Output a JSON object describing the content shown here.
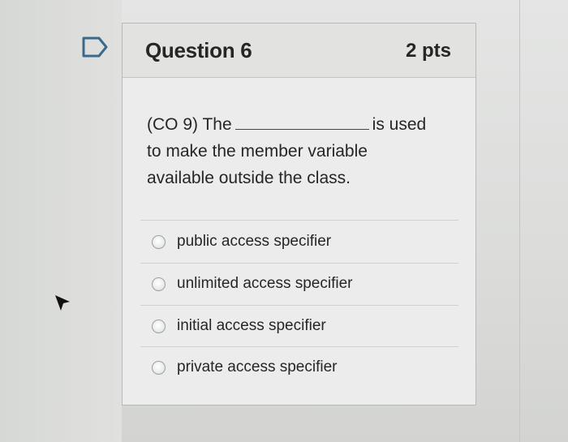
{
  "question": {
    "title": "Question 6",
    "points": "2 pts",
    "flag_icon": "flag-outline-icon",
    "text_before_blank": "(CO 9) The",
    "text_after_blank": "is used",
    "text_line2": "to make the member variable",
    "text_line3": "available outside the class."
  },
  "answers": [
    {
      "label": "public access specifier",
      "selected": false
    },
    {
      "label": "unlimited access specifier",
      "selected": false
    },
    {
      "label": "initial access specifier",
      "selected": false
    },
    {
      "label": "private access specifier",
      "selected": false
    }
  ],
  "colors": {
    "card_bg": "#ebeceb",
    "header_bg": "#e2e3e1",
    "text": "#262626",
    "border": "#b8bab8"
  }
}
